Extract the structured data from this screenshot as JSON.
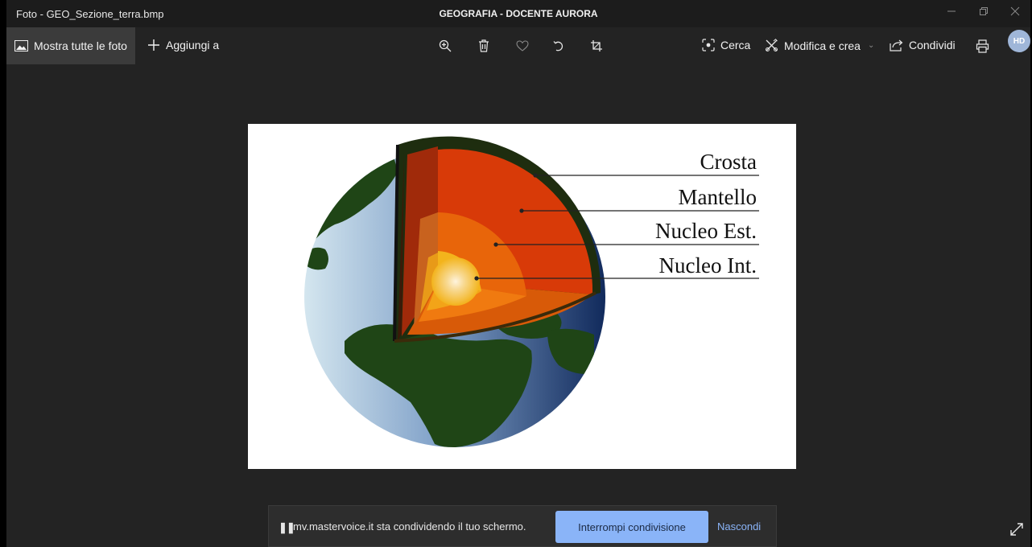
{
  "window": {
    "title": "Foto - GEO_Sezione_terra.bmp",
    "share_title": "GEOGRAFIA - DOCENTE AURORA",
    "controls": {
      "minimize_icon": "minimize-icon",
      "restore_icon": "restore-icon",
      "close_icon": "close-icon"
    }
  },
  "toolbar": {
    "show_all_label": "Mostra tutte le foto",
    "add_label": "Aggiungi a",
    "search_label": "Cerca",
    "edit_label": "Modifica e crea",
    "share_label": "Condividi",
    "avatar_initials": "HD",
    "icons": [
      "photos-icon",
      "plus-icon",
      "zoom-in-icon",
      "delete-icon",
      "favorite-icon",
      "rotate-icon",
      "crop-icon",
      "visual-search-icon",
      "edit-icon",
      "share-icon",
      "print-icon"
    ]
  },
  "image": {
    "labels": [
      "Crosta",
      "Mantello",
      "Nucleo Est.",
      "Nucleo Int."
    ]
  },
  "share_banner": {
    "message": "mv.mastervoice.it sta condividendo il tuo schermo.",
    "stop_label": "Interrompi condivisione",
    "hide_label": "Nascondi"
  },
  "colors": {
    "background": "#232323",
    "accent": "#8ab4f8",
    "crust": "#2b3a16",
    "mantle": "#d83a08",
    "outer_core": "#e8650a",
    "inner_core": "#f2b820",
    "ocean": "#6f93bd",
    "land": "#1f4516"
  }
}
